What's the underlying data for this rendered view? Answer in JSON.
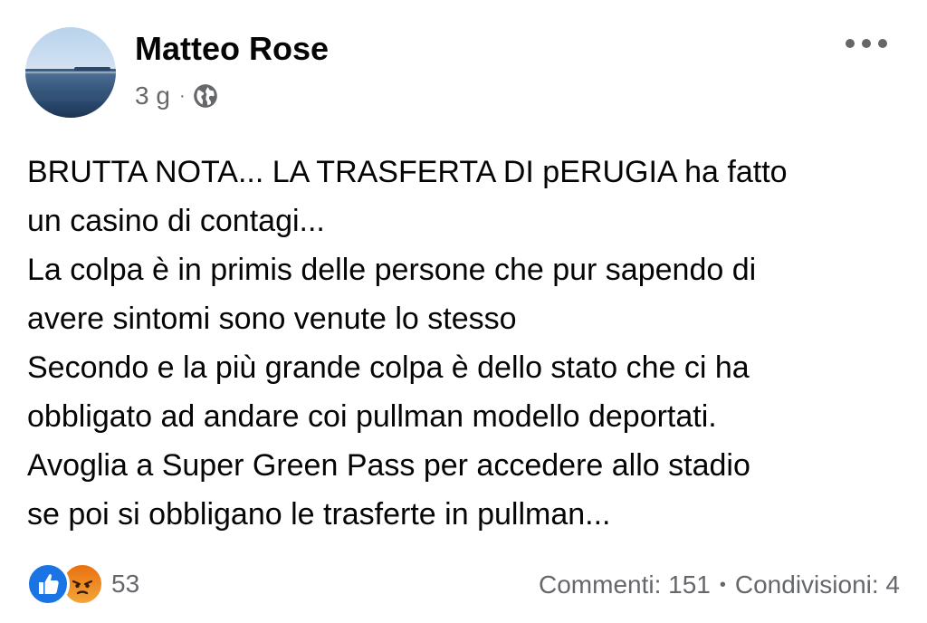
{
  "post": {
    "author": "Matteo Rose",
    "time": "3 g",
    "separator": "·",
    "privacy_icon": "globe-icon",
    "more_icon": "more-options-icon",
    "text_lines": [
      "BRUTTA NOTA... LA TRASFERTA DI pERUGIA ha fatto",
      "un casino di contagi...",
      "La colpa è in primis delle persone che pur sapendo di",
      "avere sintomi sono venute lo stesso",
      "Secondo e la più grande colpa è dello stato che ci ha",
      "obbligato ad andare coi pullman modello deportati.",
      "Avoglia a Super Green Pass per accedere allo stadio",
      "se poi si obbligano le trasferte in pullman..."
    ]
  },
  "reactions": {
    "icons": [
      "like-icon",
      "angry-icon"
    ],
    "count": "53"
  },
  "stats": {
    "comments": "Commenti: 151",
    "separator": "•",
    "shares": "Condivisioni: 4"
  },
  "colors": {
    "text": "#050505",
    "secondary": "#65676b",
    "like_blue": "#1b74e4",
    "angry_orange": "#e9710f"
  }
}
